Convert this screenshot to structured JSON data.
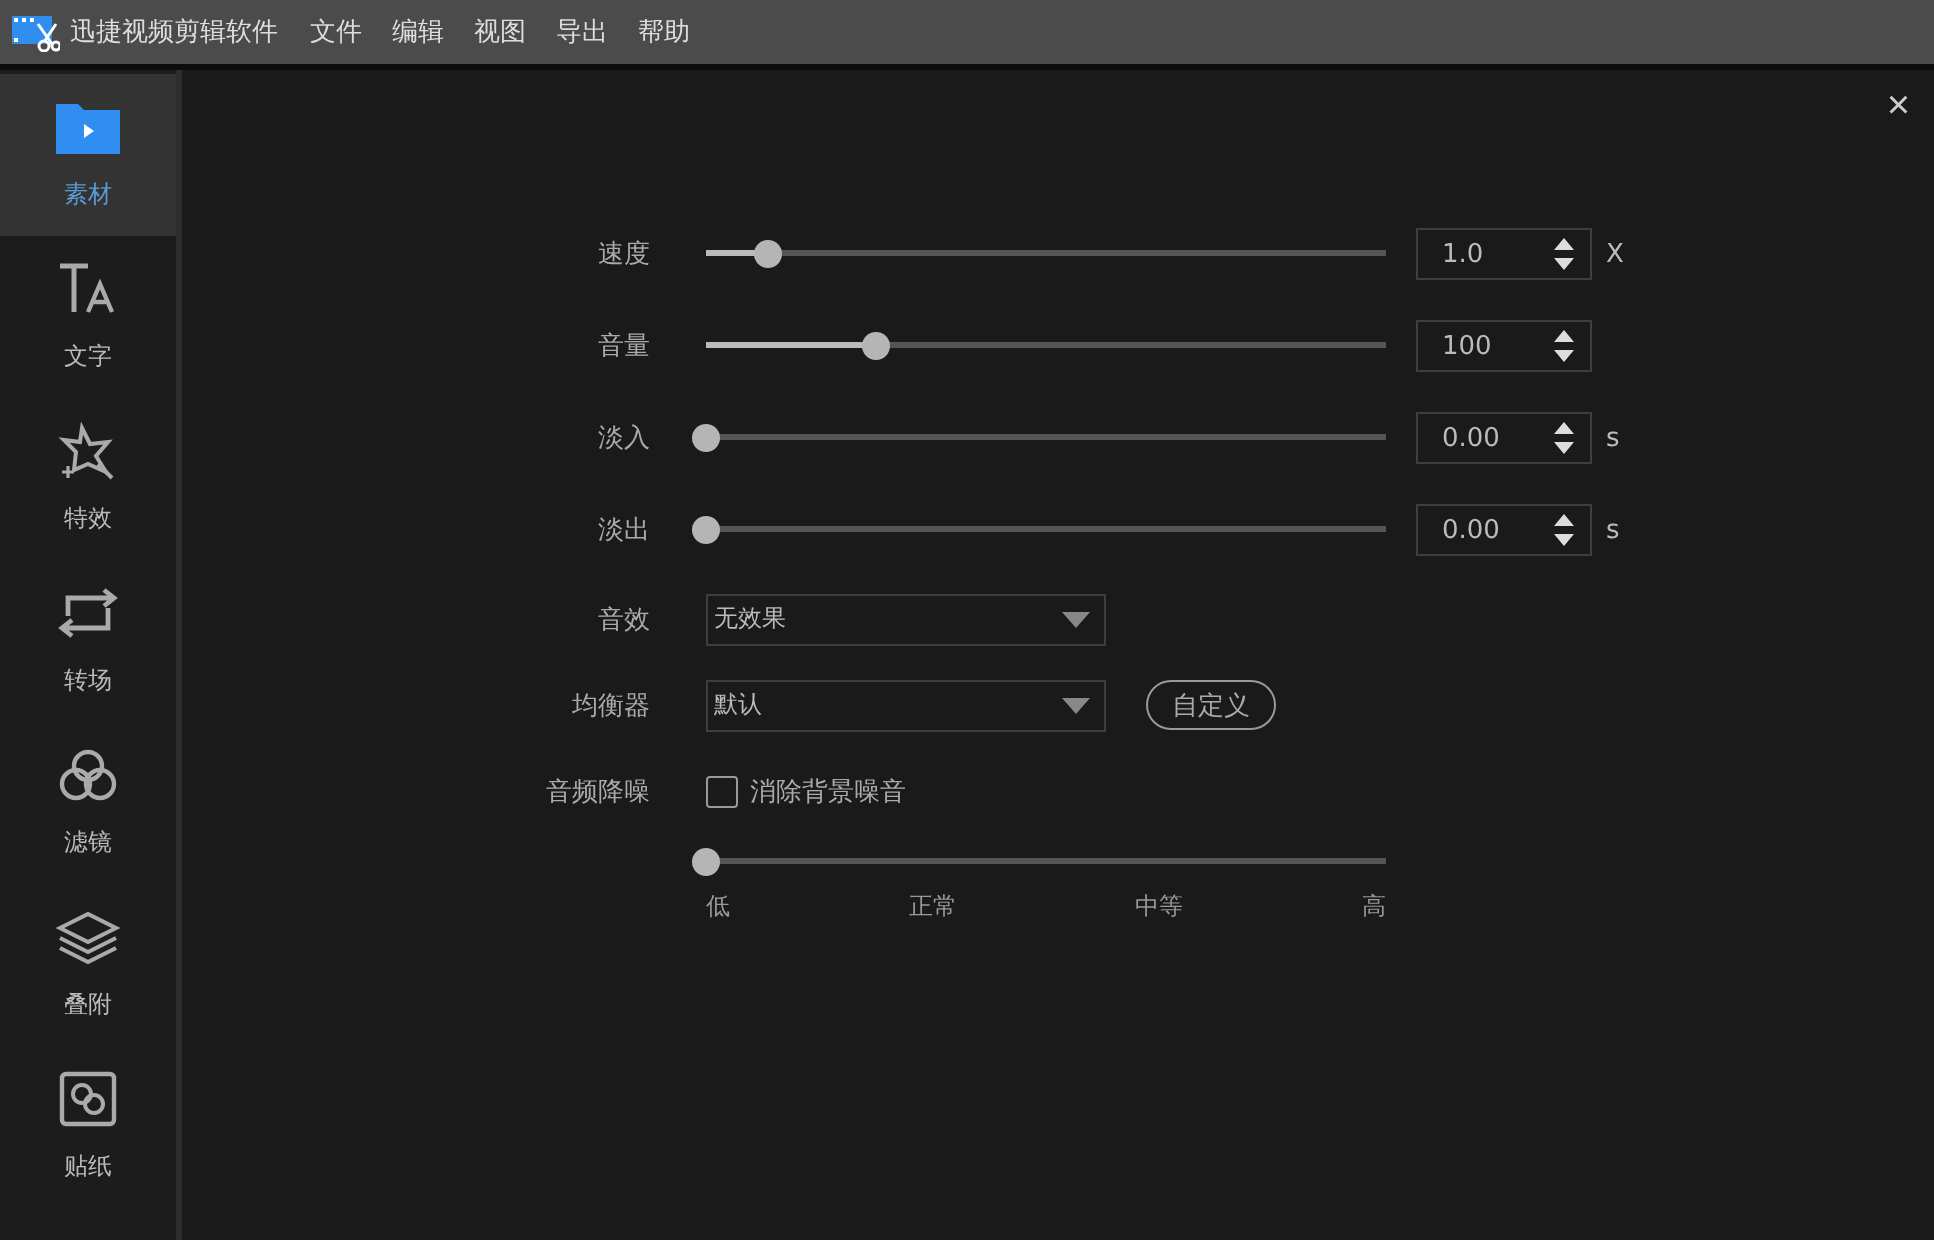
{
  "app": {
    "title": "迅捷视频剪辑软件"
  },
  "menu": [
    "文件",
    "编辑",
    "视图",
    "导出",
    "帮助"
  ],
  "sidebar": {
    "items": [
      {
        "label": "素材",
        "kind": "folder",
        "selected": true
      },
      {
        "label": "文字",
        "kind": "text",
        "selected": false
      },
      {
        "label": "特效",
        "kind": "effect",
        "selected": false
      },
      {
        "label": "转场",
        "kind": "transition",
        "selected": false
      },
      {
        "label": "滤镜",
        "kind": "filter",
        "selected": false
      },
      {
        "label": "叠附",
        "kind": "overlay",
        "selected": false
      },
      {
        "label": "贴纸",
        "kind": "sticker",
        "selected": false
      }
    ]
  },
  "panel": {
    "close": "×",
    "sliders": [
      {
        "label": "速度",
        "level": 0.09,
        "value": "1.0",
        "unit": "X"
      },
      {
        "label": "音量",
        "level": 0.25,
        "value": "100"
      },
      {
        "label": "淡入",
        "level": 0,
        "value": "0.00",
        "unit": "s"
      },
      {
        "label": "淡出",
        "level": 0,
        "value": "0.00",
        "unit": "s"
      }
    ],
    "dropdowns": [
      {
        "label": "音效",
        "value": "无效果"
      },
      {
        "label": "均衡器",
        "value": "默认",
        "button": "自定义"
      }
    ],
    "denoise": {
      "label": "音频降噪",
      "checkbox": "消除背景噪音",
      "checked": false,
      "level": 0,
      "ticks": [
        "低",
        "正常",
        "中等",
        "高"
      ]
    }
  }
}
